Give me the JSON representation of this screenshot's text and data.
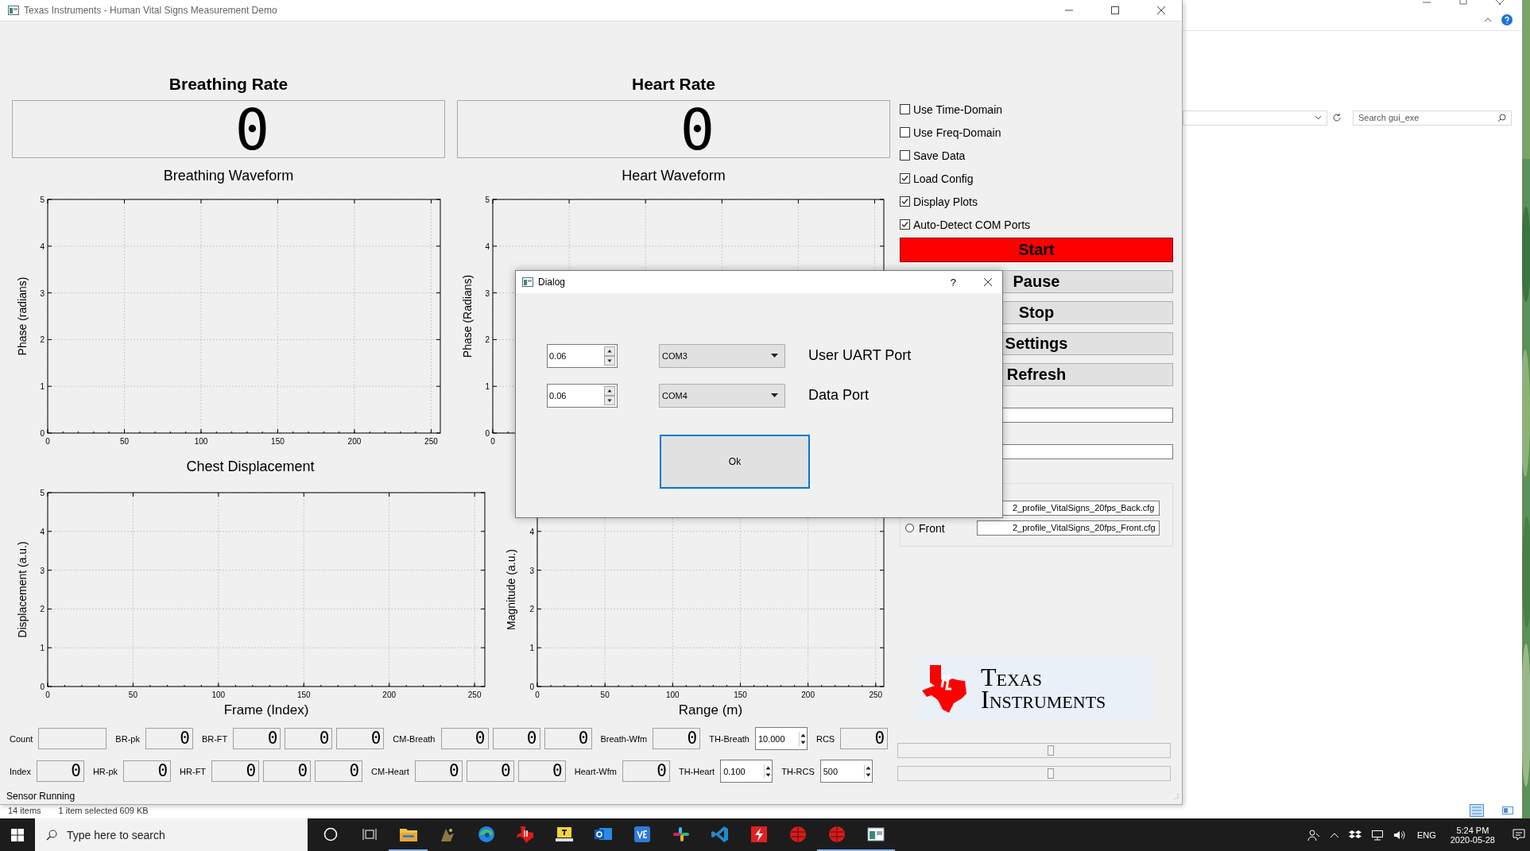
{
  "window": {
    "title": "Texas Instruments - Human Vital Signs Measurement Demo"
  },
  "rates": [
    {
      "title": "Breathing Rate",
      "value": "0"
    },
    {
      "title": "Heart Rate",
      "value": "0"
    }
  ],
  "charts": [
    {
      "title": "Breathing Waveform",
      "chart_data": {
        "type": "line",
        "grid": true,
        "ylabel": "Phase (radians)",
        "xlim": [
          0,
          256
        ],
        "ylim": [
          0,
          5
        ],
        "xticks": [
          0,
          50,
          100,
          150,
          200,
          250
        ],
        "yticks": [
          0,
          1,
          2,
          3,
          4,
          5
        ]
      }
    },
    {
      "title": "Heart Waveform",
      "plot": {
        "ylabel": "Phase (Radians)",
        "x_labels": [
          "0"
        ],
        "y_labels": [
          "5",
          "4",
          "3",
          "2",
          "1",
          "0"
        ]
      }
    },
    {
      "title": "Chest Displacement",
      "chart_data": {
        "type": "line",
        "grid": true,
        "xlabel": "Frame (Index)",
        "ylabel": "Displacement (a.u.)",
        "xlim": [
          0,
          256
        ],
        "ylim": [
          0,
          5
        ],
        "xticks": [
          0,
          50,
          100,
          150,
          200,
          250
        ],
        "yticks": [
          0,
          1,
          2,
          3,
          4,
          5
        ]
      }
    },
    {
      "chart_data": {
        "type": "line",
        "grid": true,
        "xlabel": "Range (m)",
        "ylabel": "Magnitude (a.u.)",
        "xlim": [
          0,
          256
        ],
        "ylim": [
          0,
          5
        ],
        "xticks": [
          0,
          50,
          100,
          150,
          200,
          250
        ],
        "yticks": [
          0,
          1,
          2,
          3,
          4
        ]
      }
    }
  ],
  "options": [
    {
      "label": "Use Time-Domain",
      "checked": false
    },
    {
      "label": "Use Freq-Domain",
      "checked": false
    },
    {
      "label": "Save Data",
      "checked": false
    },
    {
      "label": "Load Config",
      "checked": true
    },
    {
      "label": "Display Plots",
      "checked": true
    },
    {
      "label": "Auto-Detect COM Ports",
      "checked": true
    }
  ],
  "buttons": [
    {
      "label": "Start",
      "kind": "primary"
    },
    {
      "label": "Pause",
      "kind": "normal"
    },
    {
      "label": "Stop",
      "kind": "normal"
    },
    {
      "label": "Settings",
      "kind": "normal"
    },
    {
      "label": "Refresh",
      "kind": "normal"
    }
  ],
  "config": {
    "files": [
      "2_profile_VitalSigns_20fps_Back.cfg",
      "2_profile_VitalSigns_20fps_Front.cfg"
    ],
    "radio": {
      "label": "Front",
      "selected": false
    }
  },
  "logo": {
    "text": "Texas Instruments"
  },
  "readouts": [
    {
      "items": [
        {
          "kind": "label",
          "text": "Count"
        },
        {
          "kind": "blank-lcd"
        },
        {
          "kind": "label",
          "text": "BR-pk"
        },
        {
          "kind": "lcd",
          "value": "0"
        },
        {
          "kind": "label",
          "text": "BR-FT"
        },
        {
          "kind": "lcd",
          "value": "0"
        },
        {
          "kind": "lcd",
          "value": "0"
        },
        {
          "kind": "lcd",
          "value": "0"
        },
        {
          "kind": "label",
          "text": "CM-Breath"
        },
        {
          "kind": "lcd",
          "value": "0"
        },
        {
          "kind": "lcd",
          "value": "0"
        },
        {
          "kind": "lcd",
          "value": "0"
        },
        {
          "kind": "label",
          "text": "Breath-Wfm"
        },
        {
          "kind": "lcd",
          "value": "0"
        },
        {
          "kind": "label",
          "text": "TH-Breath"
        },
        {
          "kind": "spin",
          "value": "10.000"
        },
        {
          "kind": "label",
          "text": "RCS"
        },
        {
          "kind": "lcd",
          "value": "0"
        }
      ]
    },
    {
      "items": [
        {
          "kind": "label",
          "text": "Index"
        },
        {
          "kind": "lcd",
          "value": "0"
        },
        {
          "kind": "label",
          "text": "HR-pk"
        },
        {
          "kind": "lcd",
          "value": "0"
        },
        {
          "kind": "label",
          "text": "HR-FT"
        },
        {
          "kind": "lcd",
          "value": "0"
        },
        {
          "kind": "lcd",
          "value": "0"
        },
        {
          "kind": "lcd",
          "value": "0"
        },
        {
          "kind": "label",
          "text": "CM-Heart"
        },
        {
          "kind": "lcd",
          "value": "0"
        },
        {
          "kind": "lcd",
          "value": "0"
        },
        {
          "kind": "lcd",
          "value": "0"
        },
        {
          "kind": "label",
          "text": "Heart-Wfm"
        },
        {
          "kind": "lcd",
          "value": "0"
        },
        {
          "kind": "label",
          "text": "TH-Heart"
        },
        {
          "kind": "spin",
          "value": "0.100"
        },
        {
          "kind": "label",
          "text": "TH-RCS"
        },
        {
          "kind": "spin",
          "value": "500"
        }
      ]
    }
  ],
  "sliders": [
    {
      "level": 0.56
    },
    {
      "level": 0.56
    }
  ],
  "status_bar": "Sensor Running",
  "dialog": {
    "title": "Dialog",
    "help": "?",
    "rows": [
      {
        "spin": "0.06",
        "port": "COM3",
        "label": "User UART Port"
      },
      {
        "spin": "0.06",
        "port": "COM4",
        "label": "Data Port"
      }
    ],
    "ok": "Ok"
  },
  "explorer": {
    "search": {
      "placeholder": "Search gui_exe"
    },
    "status": [
      "14 items",
      "1 item selected  609 KB"
    ]
  },
  "taskbar": {
    "search": {
      "placeholder": "Type here to search"
    },
    "apps": [
      {
        "running": true
      },
      {
        "running": false
      },
      {
        "running": false
      },
      {
        "running": false
      },
      {
        "running": false
      },
      {
        "running": false
      },
      {
        "running": false
      },
      {
        "running": false
      },
      {
        "running": false
      },
      {
        "running": false
      },
      {
        "running": false
      },
      {
        "running": true
      },
      {
        "running": true
      }
    ],
    "language": "ENG",
    "time": "5:24 PM",
    "date": "2020-05-28"
  }
}
